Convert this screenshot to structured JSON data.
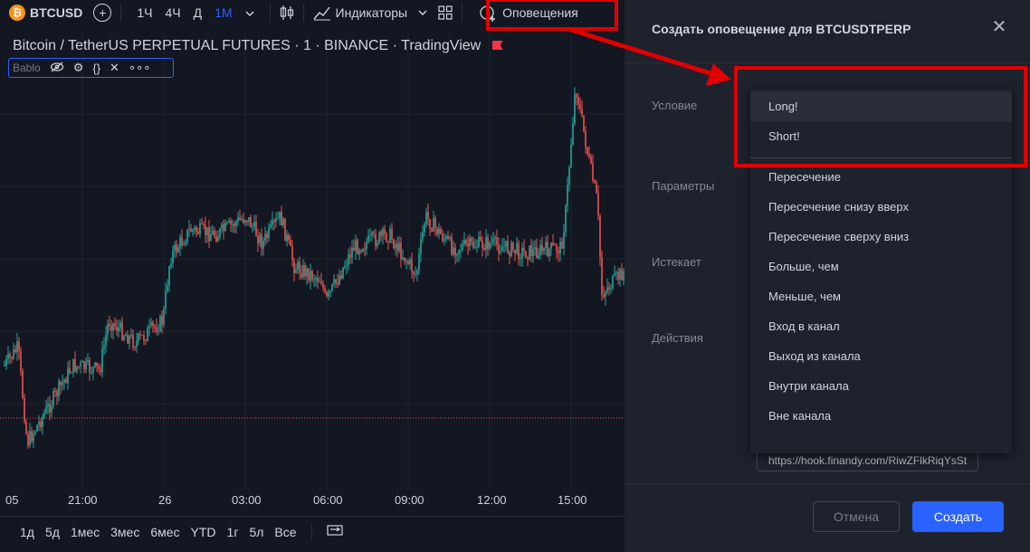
{
  "toolbar": {
    "symbol": "BTCUSD",
    "btc_glyph": "₿",
    "add_symbol_icon": "plus-circle-icon",
    "timeframes": [
      "1Ч",
      "4Ч",
      "Д",
      "1М"
    ],
    "active_timeframe": "1М",
    "timeframe_menu_icon": "chevron-down-icon",
    "chart_type_icon": "candles-icon",
    "indicators_label": "Индикаторы",
    "indicators_icon": "trend-icon",
    "layout_icon": "grid-icon",
    "alerts_label": "Оповещения",
    "alerts_icon": "alarm-clock-icon"
  },
  "chart": {
    "legend_title": "Bitcoin / TetherUS PERPETUAL FUTURES · 1 · BINANCE · TradingView",
    "indicator": {
      "name": "Bablo",
      "icons": [
        "eye-off-icon",
        "gear-icon",
        "braces-icon",
        "close-icon",
        "more-icon"
      ]
    },
    "colors": {
      "up": "#26a69a",
      "down": "#ef5350",
      "background": "#131722",
      "grid": "#1f2330"
    },
    "time_labels": [
      "05",
      "21:00",
      "26",
      "03:00",
      "06:00",
      "09:00",
      "12:00",
      "15:00"
    ]
  },
  "range_bar": {
    "ranges": [
      "1д",
      "5д",
      "1мес",
      "3мес",
      "6мес",
      "YTD",
      "1г",
      "5л",
      "Все"
    ],
    "compare_icon": "compare-icon"
  },
  "dialog": {
    "title": "Создать оповещение для BTCUSDTPERP",
    "close_icon": "close-icon",
    "labels": {
      "condition": "Условие",
      "parameters": "Параметры",
      "expires": "Истекает",
      "actions": "Действия"
    },
    "webhook_value": "https://hook.finandy.com/RiwZFlkRiqYsSt",
    "cancel_label": "Отмена",
    "create_label": "Создать",
    "accent": "#2962ff"
  },
  "dropdown": {
    "highlighted_items": [
      "Long!",
      "Short!"
    ],
    "selected": "Long!",
    "items": [
      "Пересечение",
      "Пересечение снизу вверх",
      "Пересечение сверху вниз",
      "Больше, чем",
      "Меньше, чем",
      "Вход в канал",
      "Выход из канала",
      "Внутри канала",
      "Вне канала"
    ]
  },
  "annotation_color": "#e00000"
}
